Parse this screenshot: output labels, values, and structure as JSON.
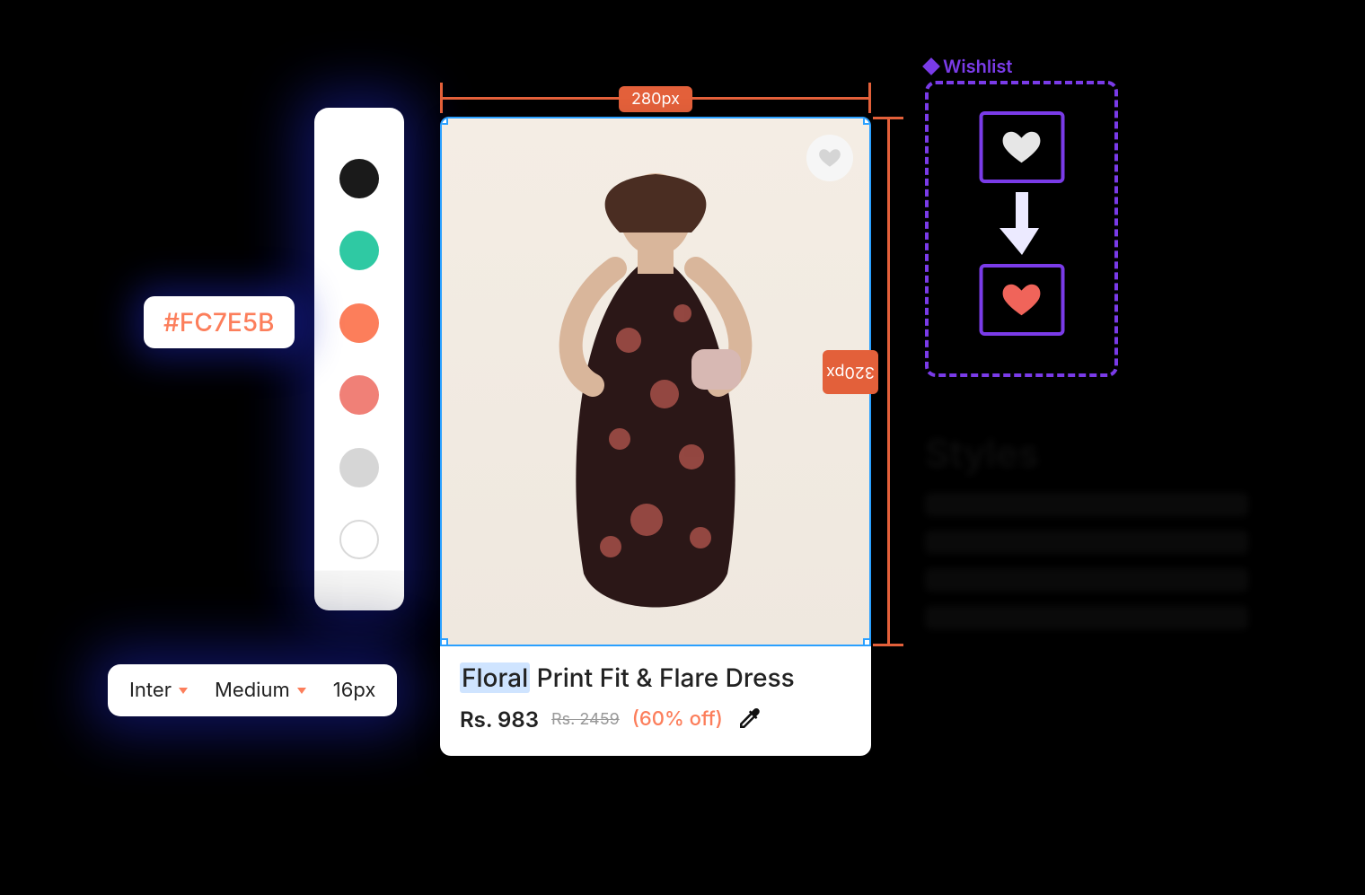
{
  "palette": {
    "colors": [
      "#1a1a1a",
      "#2fc9a3",
      "#fc7e5b",
      "#f08077",
      "#d6d6d6",
      "#ffffff"
    ],
    "active_hex": "#FC7E5B"
  },
  "typography": {
    "font_family": "Inter",
    "weight": "Medium",
    "size_label": "16px"
  },
  "product": {
    "title_highlight": "Floral",
    "title_rest": " Print Fit & Flare Dress",
    "price": "Rs. 983",
    "old_price": "Rs. 2459",
    "discount": "(60% off)"
  },
  "rulers": {
    "width_label": "280px",
    "height_label": "320px"
  },
  "inspector": {
    "wishlist_label": "Wishlist",
    "faded_heading": "Styles"
  }
}
